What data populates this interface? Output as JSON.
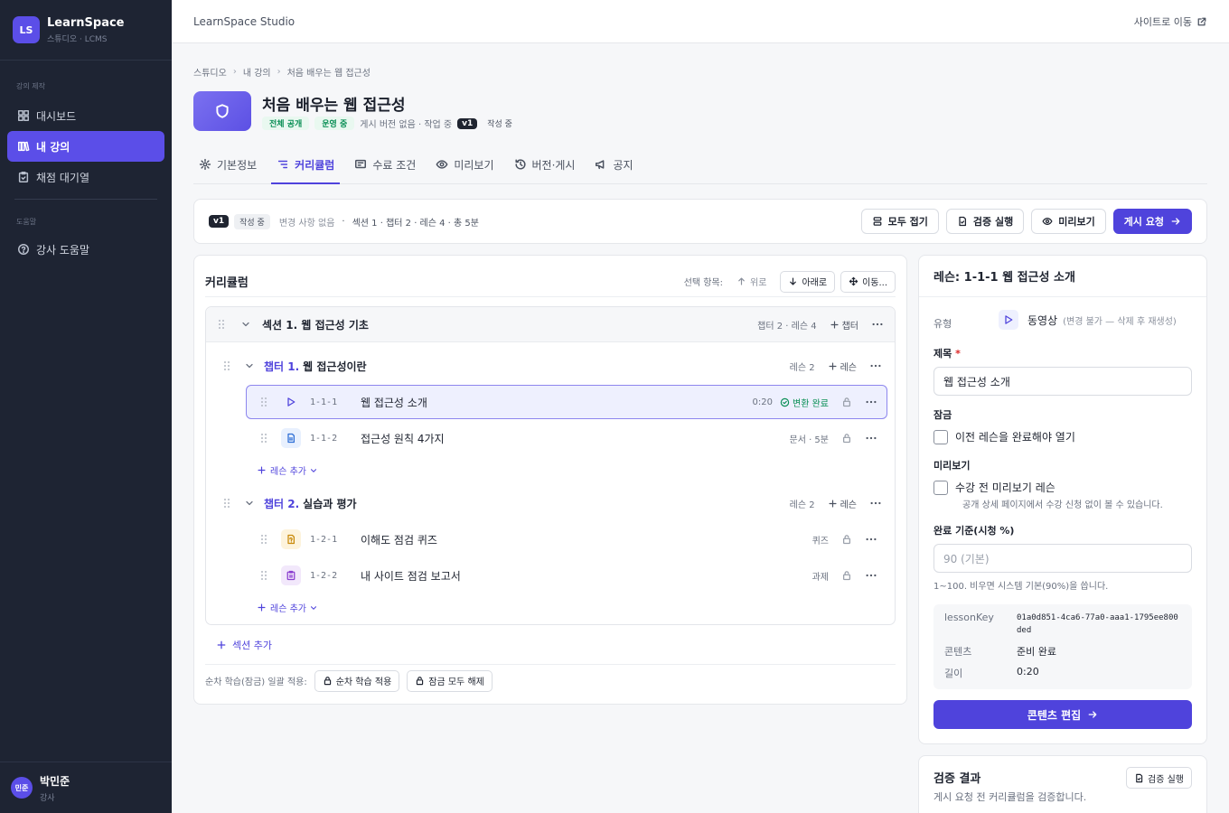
{
  "brand": {
    "logo": "LS",
    "name": "LearnSpace",
    "sub": "스튜디오 · LCMS"
  },
  "sidebar": {
    "section1": "강의 제작",
    "items": [
      {
        "label": "대시보드",
        "icon": "grid-icon"
      },
      {
        "label": "내 강의",
        "icon": "book-icon"
      },
      {
        "label": "채점 대기열",
        "icon": "clipboard-icon"
      }
    ],
    "section2": "도움말",
    "help": "강사 도움말",
    "user": {
      "initials": "민준",
      "name": "박민준",
      "role": "강사"
    }
  },
  "topbar": {
    "title": "LearnSpace Studio",
    "site_link": "사이트로 이동"
  },
  "breadcrumb": [
    "스튜디오",
    "내 강의",
    "처음 배우는 웹 접근성"
  ],
  "course": {
    "title": "처음 배우는 웹 접근성",
    "visibility": "전체 공개",
    "status": "운영 중",
    "publish_info": "게시 버전 없음 · 작업 중",
    "version": "v1",
    "draft": "작성 중"
  },
  "tabs": [
    "기본정보",
    "커리큘럼",
    "수료 조건",
    "미리보기",
    "버전·게시",
    "공지"
  ],
  "toolbar": {
    "version": "v1",
    "state": "작성 중",
    "changes": "변경 사항 없음",
    "dot": "·",
    "summary": "섹션 1 · 챕터 2 · 레슨 4 · 총 5분",
    "collapse": "모두 접기",
    "validate": "검증 실행",
    "preview": "미리보기",
    "publish": "게시 요청"
  },
  "curriculum": {
    "title": "커리큘럼",
    "selected_label": "선택 항목:",
    "up": "위로",
    "down": "아래로",
    "move": "이동...",
    "section": {
      "num": "섹션 1.",
      "title": "웹 접근성 기초",
      "meta": "챕터 2 · 레슨 4",
      "add": "챕터"
    },
    "chapters": [
      {
        "num": "챕터 1.",
        "title": "웹 접근성이란",
        "meta": "레슨 2",
        "add": "레슨",
        "lessons": [
          {
            "code": "1-1-1",
            "title": "웹 접근성 소개",
            "meta": "0:20",
            "status": "변환 완료",
            "type": "video"
          },
          {
            "code": "1-1-2",
            "title": "접근성 원칙 4가지",
            "meta": "문서 · 5분",
            "status": "",
            "type": "doc"
          }
        ]
      },
      {
        "num": "챕터 2.",
        "title": "실습과 평가",
        "meta": "레슨 2",
        "add": "레슨",
        "lessons": [
          {
            "code": "1-2-1",
            "title": "이해도 점검 퀴즈",
            "meta": "퀴즈",
            "status": "",
            "type": "quiz"
          },
          {
            "code": "1-2-2",
            "title": "내 사이트 점검 보고서",
            "meta": "과제",
            "status": "",
            "type": "assignment"
          }
        ]
      }
    ],
    "add_lesson": "레슨 추가",
    "add_section": "섹션 추가",
    "seq_label": "순차 학습(잠금) 일괄 적용:",
    "seq_apply": "순차 학습 적용",
    "seq_unlock": "잠금 모두 해제"
  },
  "panel": {
    "title": "레슨: 1-1-1 웹 접근성 소개",
    "type_label": "유형",
    "type_value": "동영상",
    "type_note": "(변경 불가 — 삭제 후 재생성)",
    "name_label": "제목",
    "required": "*",
    "name_value": "웹 접근성 소개",
    "lock_label": "잠금",
    "lock_check": "이전 레슨을 완료해야 열기",
    "preview_label": "미리보기",
    "preview_check": "수강 전 미리보기 레슨",
    "preview_help": "공개 상세 페이지에서 수강 신청 없이 볼 수 있습니다.",
    "complete_label": "완료 기준(시청 %)",
    "complete_placeholder": "90 (기본)",
    "complete_help": "1~100. 비우면 시스템 기본(90%)을 씁니다.",
    "info": [
      {
        "k": "lessonKey",
        "v": "01a0d851-4ca6-77a0-aaa1-1795ee800ded"
      },
      {
        "k": "콘텐츠",
        "v": "준비 완료"
      },
      {
        "k": "길이",
        "v": "0:20"
      }
    ],
    "edit": "콘텐츠 편집"
  },
  "verify": {
    "title": "검증 결과",
    "sub": "게시 요청 전 커리큘럼을 검증합니다.",
    "button": "검증 실행"
  },
  "colors": {
    "accent": "#4f43dc",
    "sidebar": "#1e2433",
    "success": "#0a8f55"
  }
}
